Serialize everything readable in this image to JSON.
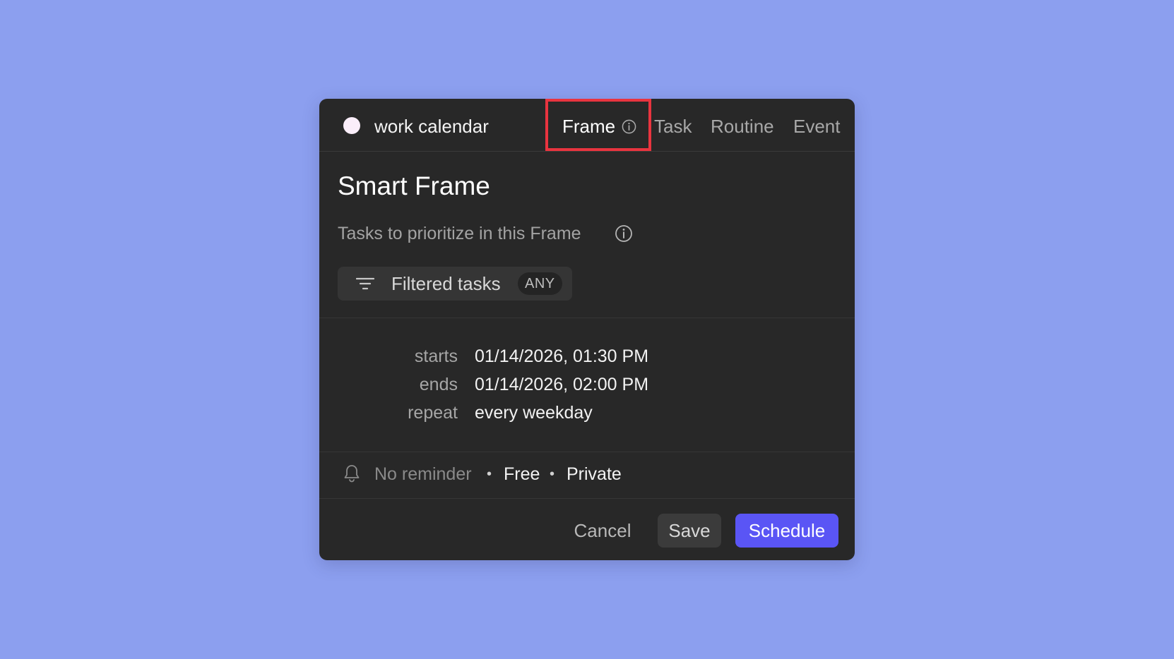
{
  "header": {
    "calendar_name": "work calendar",
    "tabs": [
      {
        "label": "Frame",
        "selected": true,
        "icon": "info-icon"
      },
      {
        "label": "Task",
        "selected": false
      },
      {
        "label": "Routine",
        "selected": false
      },
      {
        "label": "Event",
        "selected": false
      }
    ]
  },
  "main": {
    "title": "Smart Frame",
    "subtitle": "Tasks to prioritize in this Frame",
    "filter": {
      "label": "Filtered tasks",
      "badge": "ANY"
    }
  },
  "schedule": {
    "starts_label": "starts",
    "starts_value": "01/14/2026, 01:30 PM",
    "ends_label": "ends",
    "ends_value": "01/14/2026, 02:00 PM",
    "repeat_label": "repeat",
    "repeat_value": "every weekday"
  },
  "meta": {
    "reminder": "No reminder",
    "separator": "•",
    "availability": "Free",
    "visibility": "Private"
  },
  "actions": {
    "cancel": "Cancel",
    "save": "Save",
    "schedule": "Schedule"
  },
  "colors": {
    "background": "#8c9fef",
    "dialog": "#282828",
    "accent": "#5a55f5",
    "highlight": "#e9343f",
    "calendar_dot": "#fbeefa"
  }
}
